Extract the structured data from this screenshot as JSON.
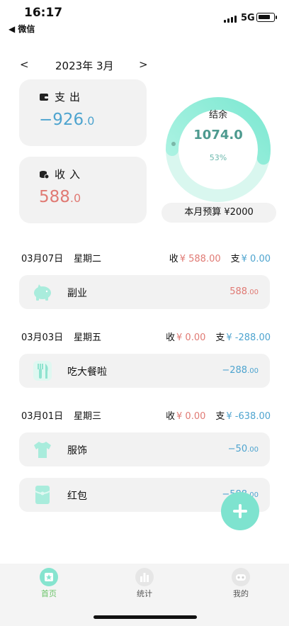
{
  "status_bar": {
    "time": "16:17",
    "back_app": "◀ 微信",
    "network": "5G"
  },
  "month": {
    "prev": "<",
    "label": "2023年 3月",
    "next": ">"
  },
  "summary": {
    "expense": {
      "title": "支出",
      "amount_int": "−926",
      "amount_dec": ".0"
    },
    "income": {
      "title": "收入",
      "amount_int": "588",
      "amount_dec": ".0"
    }
  },
  "balance": {
    "label": "结余",
    "value": "1074.0",
    "percent_text": "53%",
    "ring_fraction": 0.53
  },
  "budget": {
    "text": "本月预算 ¥2000"
  },
  "days": [
    {
      "date": "03月07日",
      "weekday": "星期二",
      "income_label": "收",
      "income": "¥ 588.00",
      "expense_label": "支",
      "expense": "¥ 0.00",
      "records": [
        {
          "icon": "piggy-bank-icon",
          "name": "副业",
          "amount_int": "588",
          "amount_dec": ".00",
          "kind": "inc"
        }
      ]
    },
    {
      "date": "03月03日",
      "weekday": "星期五",
      "income_label": "收",
      "income": "¥ 0.00",
      "expense_label": "支",
      "expense": "¥ -288.00",
      "records": [
        {
          "icon": "utensils-icon",
          "name": "吃大餐啦",
          "amount_int": "−288",
          "amount_dec": ".00",
          "kind": "exp"
        }
      ]
    },
    {
      "date": "03月01日",
      "weekday": "星期三",
      "income_label": "收",
      "income": "¥ 0.00",
      "expense_label": "支",
      "expense": "¥ -638.00",
      "records": [
        {
          "icon": "tshirt-icon",
          "name": "服饰",
          "amount_int": "−50",
          "amount_dec": ".00",
          "kind": "exp"
        },
        {
          "icon": "red-envelope-icon",
          "name": "红包",
          "amount_int": "−588",
          "amount_dec": ".00",
          "kind": "exp"
        }
      ]
    }
  ],
  "tabs": [
    {
      "label": "首页",
      "icon": "home-icon",
      "active": true
    },
    {
      "label": "统计",
      "icon": "chart-icon",
      "active": false
    },
    {
      "label": "我的",
      "icon": "profile-icon",
      "active": false
    }
  ],
  "colors": {
    "accent": "#7ee3cf",
    "income": "#e07a74",
    "expense": "#4ea4cf",
    "card": "#f2f2f2"
  }
}
